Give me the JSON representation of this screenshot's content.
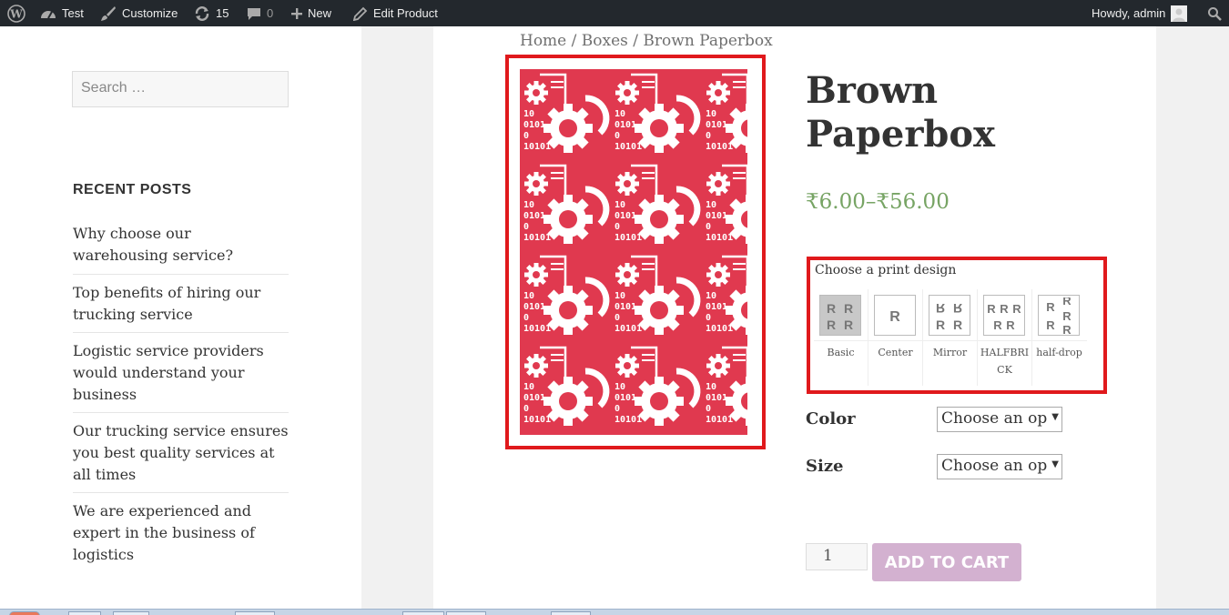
{
  "adminbar": {
    "site_name": "Test",
    "customize": "Customize",
    "updates_count": "15",
    "comments_count": "0",
    "new_label": "New",
    "edit_label": "Edit Product",
    "howdy": "Howdy, admin"
  },
  "sidebar": {
    "search_placeholder": "Search …",
    "recent_title": "RECENT POSTS",
    "posts": [
      "Why choose our warehousing service?",
      "Top benefits of hiring our trucking service",
      "Logistic service providers would understand your business",
      "Our trucking service ensures you best quality services at all times",
      "We are experienced and expert in the business of logistics"
    ]
  },
  "breadcrumb": "Home / Boxes / Brown Paperbox",
  "product": {
    "title": "Brown Paperbox",
    "price": "₹6.00–₹56.00",
    "image_color": "#e0394f"
  },
  "design": {
    "label": "Choose a print design",
    "options": [
      {
        "name": "Basic",
        "thumb": "R R\nR R",
        "selected": true
      },
      {
        "name": "Center",
        "thumb": "R",
        "selected": false
      },
      {
        "name": "Mirror",
        "thumb": "ꓤ ꓤ\nR R",
        "selected": false
      },
      {
        "name": "HALFBRICK",
        "thumb": "R R R\nR R",
        "selected": false
      },
      {
        "name": "half-drop",
        "thumb": "R ꓤ\nR R",
        "selected": false
      }
    ]
  },
  "attributes": {
    "color_label": "Color",
    "color_value": "Choose an op",
    "size_label": "Size",
    "size_value": "Choose an op"
  },
  "cart": {
    "qty": "1",
    "button": "ADD TO CART"
  },
  "colors": {
    "highlight_border": "#e0191c",
    "price": "#77a464",
    "cart_button": "#d3b1d0"
  }
}
